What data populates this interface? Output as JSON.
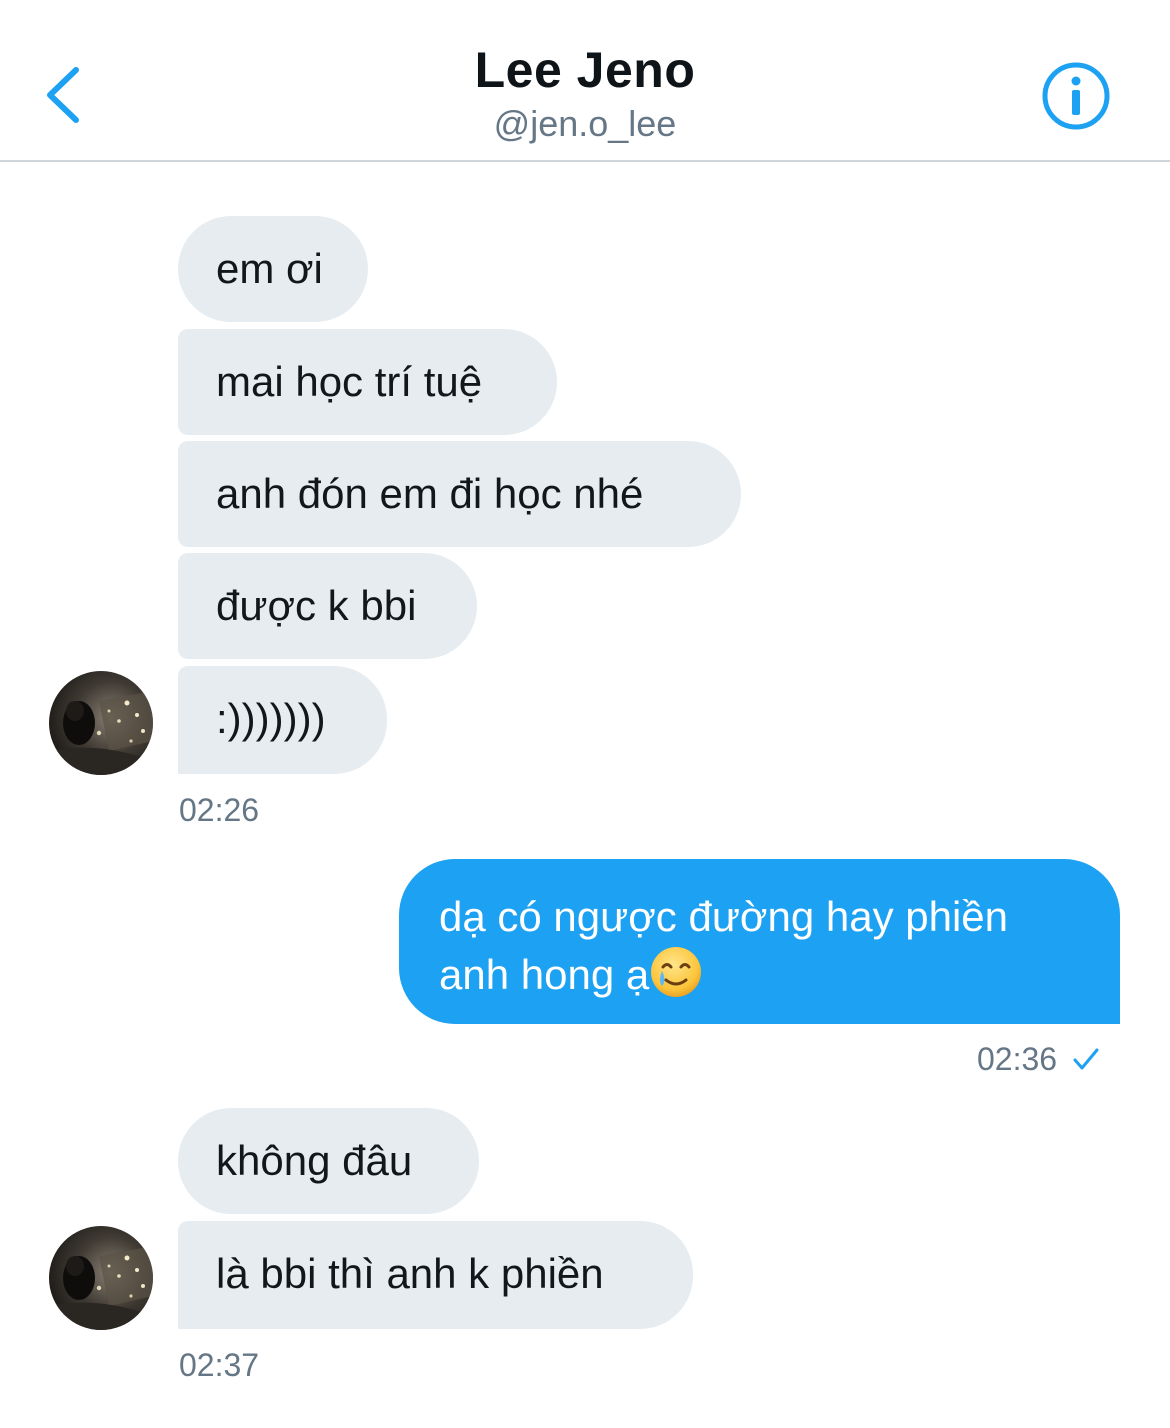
{
  "header": {
    "title": "Lee Jeno",
    "handle": "@jen.o_lee",
    "back_icon": "chevron-left-icon",
    "info_icon": "info-icon"
  },
  "colors": {
    "accent": "#1da1f2",
    "incoming_bubble": "#e6ecf0",
    "secondary_text": "#657786"
  },
  "messages": {
    "group1": {
      "items": [
        "em ơi",
        "mai học trí tuệ",
        "anh đón em đi học nhé",
        "được k bbi",
        ":)))))))"
      ],
      "time": "02:26"
    },
    "outgoing": {
      "line1": "dạ có ngược đường hay phiền",
      "line2": "anh hong ạ",
      "emoji": "smiling-face-with-tear-emoji",
      "time": "02:36",
      "status_icon": "check-icon"
    },
    "group2": {
      "items": [
        "không đâu",
        "là bbi thì anh k phiền"
      ],
      "time": "02:37"
    }
  }
}
